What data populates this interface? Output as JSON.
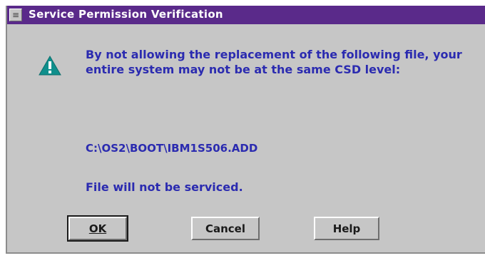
{
  "window": {
    "title": "Service Permission Verification",
    "system_menu_icon": "system-menu-icon"
  },
  "message": {
    "icon": "warning-icon",
    "icon_color": "#0f8f8c",
    "text": "By not allowing the replacement of the following file, your entire system may not be at the same CSD level:",
    "file_path": "C:\\OS2\\BOOT\\IBM1S506.ADD",
    "status": "File will not be serviced."
  },
  "buttons": {
    "ok_label": "OK",
    "cancel_label": "Cancel",
    "help_label": "Help"
  },
  "colors": {
    "title_bar": "#5a2a8a",
    "dialog_bg": "#c6c6c6",
    "message_text": "#2b2bb0"
  }
}
